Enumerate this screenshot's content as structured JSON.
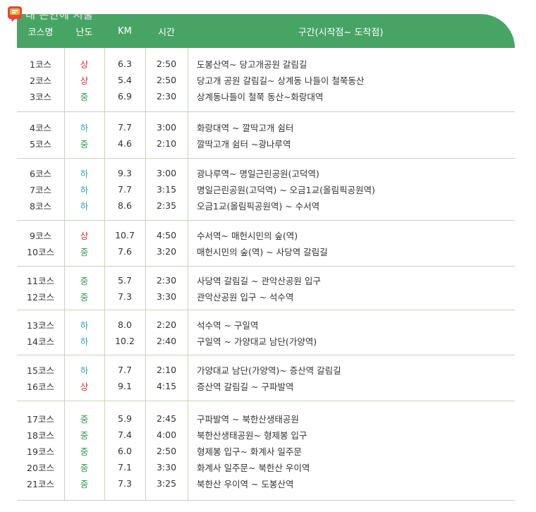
{
  "logo": {
    "icon": "seoul-news-logo-icon",
    "text": "내 손안에 서울"
  },
  "colors": {
    "header_bg": "#48a465",
    "level_high": "#d8323a",
    "level_mid": "#2f9a4c",
    "level_low": "#3aa4c4",
    "divider": "#c8d4b8"
  },
  "table": {
    "headers": [
      "코스명",
      "난도",
      "KM",
      "시간",
      "구간(시작점~ 도착점)"
    ],
    "groups": [
      {
        "rows": [
          {
            "course": "1코스",
            "level": "상",
            "km": "6.3",
            "time": "2:50",
            "section": "도봉산역~ 당고개공원 갈림길"
          },
          {
            "course": "2코스",
            "level": "상",
            "km": "5.4",
            "time": "2:50",
            "section": "당고개 공원 갈림길~ 상계동 나들이 철쭉동산"
          },
          {
            "course": "3코스",
            "level": "중",
            "km": "6.9",
            "time": "2:30",
            "section": "상계동나들이 철쭉 동산~화랑대역"
          }
        ]
      },
      {
        "rows": [
          {
            "course": "4코스",
            "level": "하",
            "km": "7.7",
            "time": "3:00",
            "section": "화랑대역 ~ 깔딱고개 쉼터"
          },
          {
            "course": "5코스",
            "level": "중",
            "km": "4.6",
            "time": "2:10",
            "section": "깔딱고개 쉼터 ~광나루역"
          }
        ]
      },
      {
        "rows": [
          {
            "course": "6코스",
            "level": "하",
            "km": "9.3",
            "time": "3:00",
            "section": "광나루역~ 명일근린공원(고덕역)"
          },
          {
            "course": "7코스",
            "level": "하",
            "km": "7.7",
            "time": "3:15",
            "section": "명일근린공원(고덕역) ~ 오금1교(올림픽공원역)"
          },
          {
            "course": "8코스",
            "level": "하",
            "km": "8.6",
            "time": "2:35",
            "section": "오금1교(올림픽공원역) ~ 수서역"
          }
        ]
      },
      {
        "rows": [
          {
            "course": "9코스",
            "level": "상",
            "km": "10.7",
            "time": "4:50",
            "section": "수서역~ 매헌시민의 숲(역)"
          },
          {
            "course": "10코스",
            "level": "중",
            "km": "7.6",
            "time": "3:20",
            "section": "매헌시민의 숲(역) ~ 사당역 갈림길"
          }
        ]
      },
      {
        "rows": [
          {
            "course": "11코스",
            "level": "중",
            "km": "5.7",
            "time": "2:30",
            "section": "사당역 갈림길 ~ 관악산공원 입구"
          },
          {
            "course": "12코스",
            "level": "중",
            "km": "7.3",
            "time": "3:30",
            "section": "관악산공원 입구 ~ 석수역"
          }
        ]
      },
      {
        "rows": [
          {
            "course": "13코스",
            "level": "하",
            "km": "8.0",
            "time": "2:20",
            "section": "석수역 ~ 구일역"
          },
          {
            "course": "14코스",
            "level": "하",
            "km": "10.2",
            "time": "2:40",
            "section": "구일역 ~ 가양대교 남단(가양역)"
          }
        ]
      },
      {
        "rows": [
          {
            "course": "15코스",
            "level": "하",
            "km": "7.7",
            "time": "2:10",
            "section": "가양대교 남단(가양역)~ 증산역 갈림길"
          },
          {
            "course": "16코스",
            "level": "상",
            "km": "9.1",
            "time": "4:15",
            "section": "증산역 갈림길 ~ 구파발역"
          }
        ]
      },
      {
        "rows": [
          {
            "course": "17코스",
            "level": "중",
            "km": "5.9",
            "time": "2:45",
            "section": "구파발역 ~ 북한산생태공원"
          },
          {
            "course": "18코스",
            "level": "중",
            "km": "7.4",
            "time": "4:00",
            "section": "북한산생태공원~ 형제봉 입구"
          },
          {
            "course": "19코스",
            "level": "중",
            "km": "6.0",
            "time": "2:50",
            "section": "형제봉 입구~ 화계사 일주문"
          },
          {
            "course": "20코스",
            "level": "중",
            "km": "7.1",
            "time": "3:30",
            "section": "화계사 일주문~ 북한산 우이역"
          },
          {
            "course": "21코스",
            "level": "중",
            "km": "7.3",
            "time": "3:25",
            "section": "북한산 우이역 ~ 도봉산역"
          }
        ]
      }
    ]
  }
}
